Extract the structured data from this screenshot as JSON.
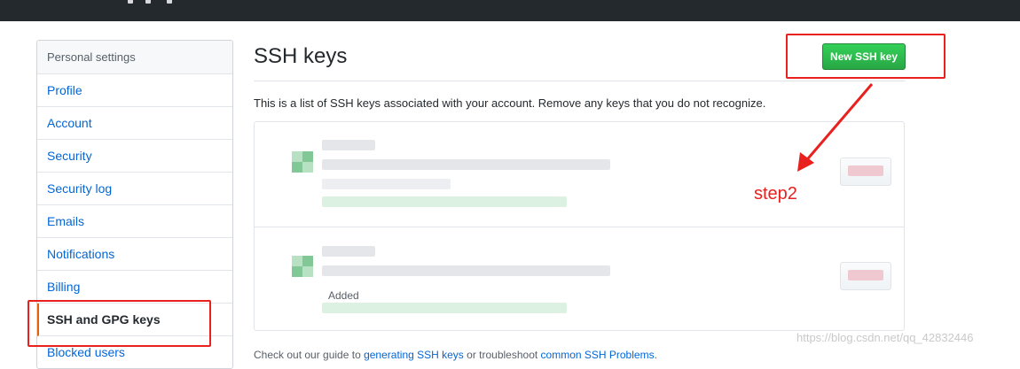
{
  "sidebar": {
    "header": "Personal settings",
    "items": [
      {
        "label": "Profile"
      },
      {
        "label": "Account"
      },
      {
        "label": "Security"
      },
      {
        "label": "Security log"
      },
      {
        "label": "Emails"
      },
      {
        "label": "Notifications"
      },
      {
        "label": "Billing"
      },
      {
        "label": "SSH and GPG keys"
      },
      {
        "label": "Blocked users"
      }
    ],
    "selected": "SSH and GPG keys"
  },
  "main": {
    "title": "SSH keys",
    "new_button": "New SSH key",
    "description": "This is a list of SSH keys associated with your account. Remove any keys that you do not recognize.",
    "keys": [
      {
        "added_prefix": ""
      },
      {
        "added_prefix": "Added"
      }
    ],
    "footer": {
      "lead": "Check out our guide to ",
      "link1": "generating SSH keys",
      "mid": " or troubleshoot ",
      "link2": "common SSH Problems",
      "tail": "."
    }
  },
  "annotations": {
    "step_label": "step2",
    "color": "#e8211e"
  },
  "watermark": "https://blog.csdn.net/qq_42832446",
  "colors": {
    "topbar": "#24292e",
    "link": "#0366d6",
    "primary_button": "#28a745",
    "selected_accent": "#e36209"
  }
}
